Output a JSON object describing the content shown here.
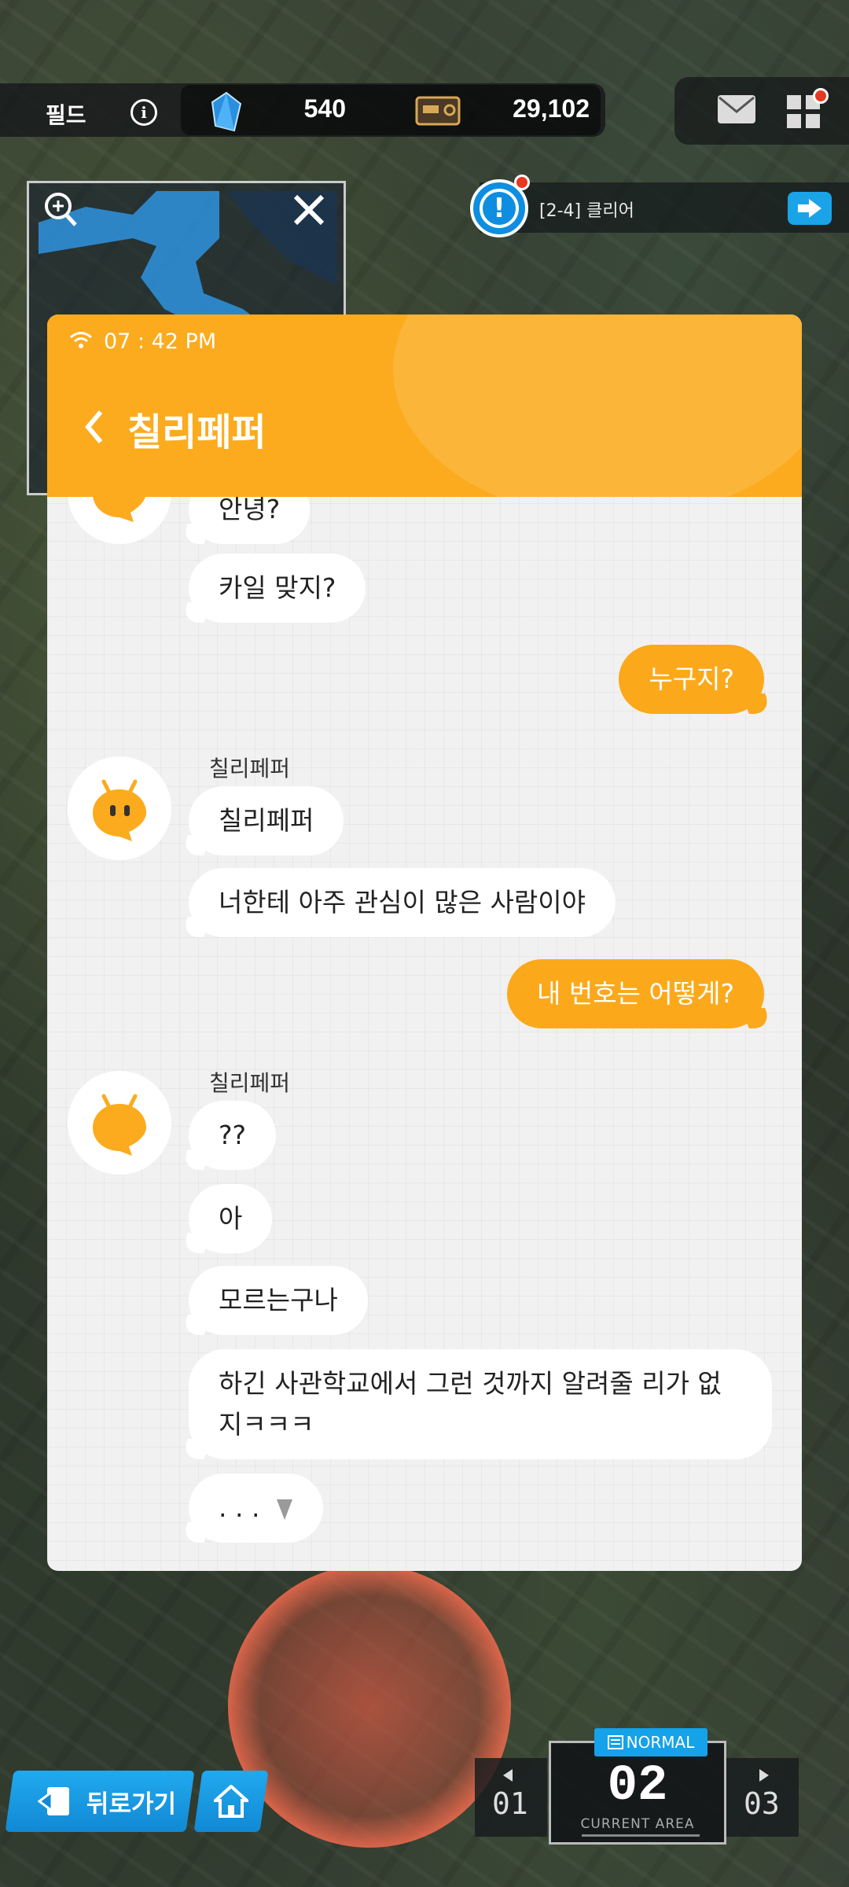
{
  "hud": {
    "field_label": "필드",
    "crystal_value": "540",
    "card_value": "29,102",
    "icons": [
      "info-icon",
      "crystal-icon",
      "card-icon",
      "mail-icon",
      "menu-grid-icon"
    ]
  },
  "quest": {
    "text": "[2-4] 클리어"
  },
  "chat": {
    "time": "07 : 42 PM",
    "title": "칠리페퍼",
    "messages": [
      {
        "side": "left",
        "text": "안녕?"
      },
      {
        "side": "left",
        "text": "카일 맞지?"
      },
      {
        "side": "right",
        "text": "누구지?"
      },
      {
        "side": "left",
        "sender": "칠리페퍼",
        "text": "칠리페퍼"
      },
      {
        "side": "left",
        "text": "너한테 아주 관심이 많은 사람이야"
      },
      {
        "side": "right",
        "text": "내 번호는 어떻게?"
      },
      {
        "side": "left",
        "sender": "칠리페퍼",
        "text": "??"
      },
      {
        "side": "left",
        "text": "아"
      },
      {
        "side": "left",
        "text": "모르는구나"
      },
      {
        "side": "left",
        "text": "하긴 사관학교에서 그런 것까지 알려줄 리가 없지ㅋㅋㅋ"
      },
      {
        "side": "left",
        "text": ". . ."
      }
    ]
  },
  "bottom": {
    "back_label": "뒤로가기",
    "difficulty": "NORMAL",
    "prev_area": "01",
    "current_area": "02",
    "next_area": "03",
    "current_area_caption": "CURRENT AREA"
  },
  "colors": {
    "accent_orange": "#fbab1d",
    "accent_blue": "#1ba3e8",
    "badge_red": "#e8381f"
  }
}
